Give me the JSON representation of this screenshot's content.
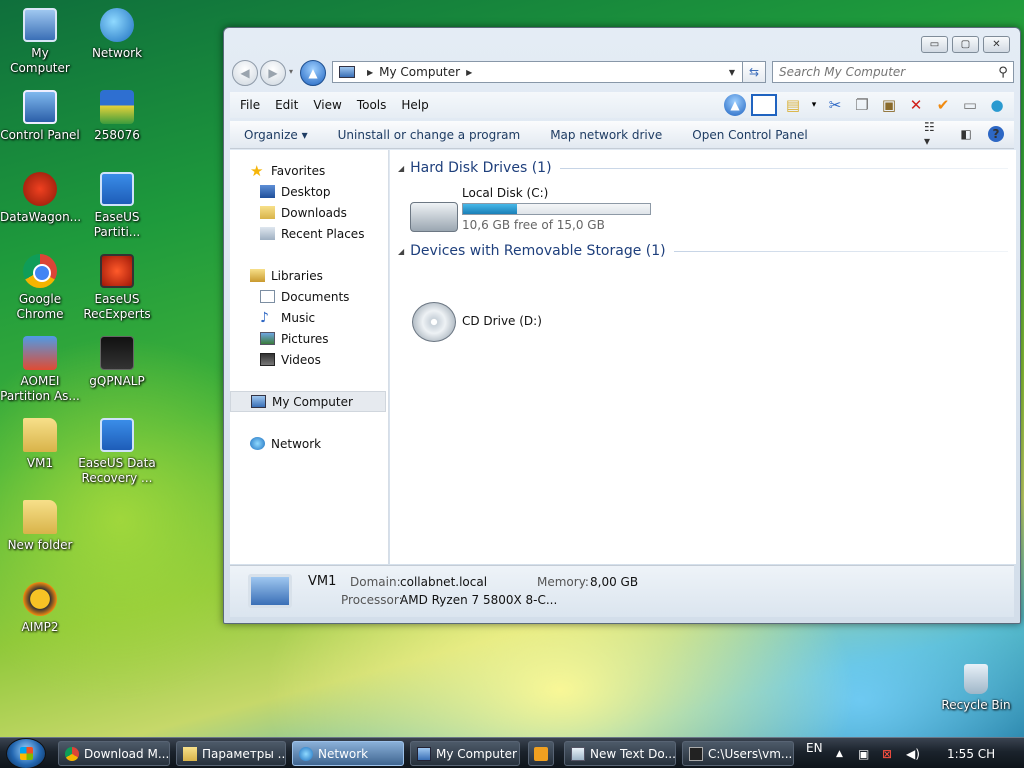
{
  "desktop": {
    "icons": [
      {
        "label": "My Computer"
      },
      {
        "label": "Network"
      },
      {
        "label": "Control Panel"
      },
      {
        "label": "258076"
      },
      {
        "label": "DataWagon..."
      },
      {
        "label": "EaseUS Partiti..."
      },
      {
        "label": "Google Chrome"
      },
      {
        "label": "EaseUS RecExperts"
      },
      {
        "label": "AOMEI Partition As..."
      },
      {
        "label": "gQPNALP"
      },
      {
        "label": "VM1"
      },
      {
        "label": "EaseUS Data Recovery ..."
      },
      {
        "label": "New folder"
      },
      {
        "label": "AIMP2"
      },
      {
        "label": "Recycle Bin"
      }
    ]
  },
  "window": {
    "caption": {
      "minimize": "▭",
      "maximize": "▢",
      "close": "✕"
    },
    "address": {
      "location": "My Computer"
    },
    "search": {
      "placeholder": "Search My Computer"
    },
    "menu": [
      "File",
      "Edit",
      "View",
      "Tools",
      "Help"
    ],
    "commands": [
      "Organize ▾",
      "Uninstall or change a program",
      "Map network drive",
      "Open Control Panel"
    ],
    "nav": {
      "favorites": "Favorites",
      "desktop": "Desktop",
      "downloads": "Downloads",
      "recent": "Recent Places",
      "libraries": "Libraries",
      "documents": "Documents",
      "music": "Music",
      "pictures": "Pictures",
      "videos": "Videos",
      "my_computer": "My Computer",
      "network": "Network"
    },
    "groups": {
      "hdd": "Hard Disk Drives (1)",
      "removable": "Devices with Removable Storage (1)"
    },
    "drives": {
      "c_name": "Local Disk (C:)",
      "c_free": "10,6 GB free of 15,0 GB",
      "c_used_fraction": 0.29,
      "d_name": "CD Drive (D:)"
    },
    "details": {
      "name": "VM1",
      "domain_label": "Domain:",
      "domain": "collabnet.local",
      "memory_label": "Memory:",
      "memory": "8,00 GB",
      "processor_label": "Processor:",
      "processor": "AMD Ryzen 7 5800X 8-C..."
    }
  },
  "taskbar": {
    "buttons": [
      {
        "label": "Download M..."
      },
      {
        "label": "Параметры ..."
      },
      {
        "label": "Network"
      },
      {
        "label": "My Computer"
      },
      {
        "label": "New Text Do..."
      },
      {
        "label": "C:\\Users\\vm..."
      }
    ],
    "language": "EN",
    "clock": "1:55 CH"
  }
}
